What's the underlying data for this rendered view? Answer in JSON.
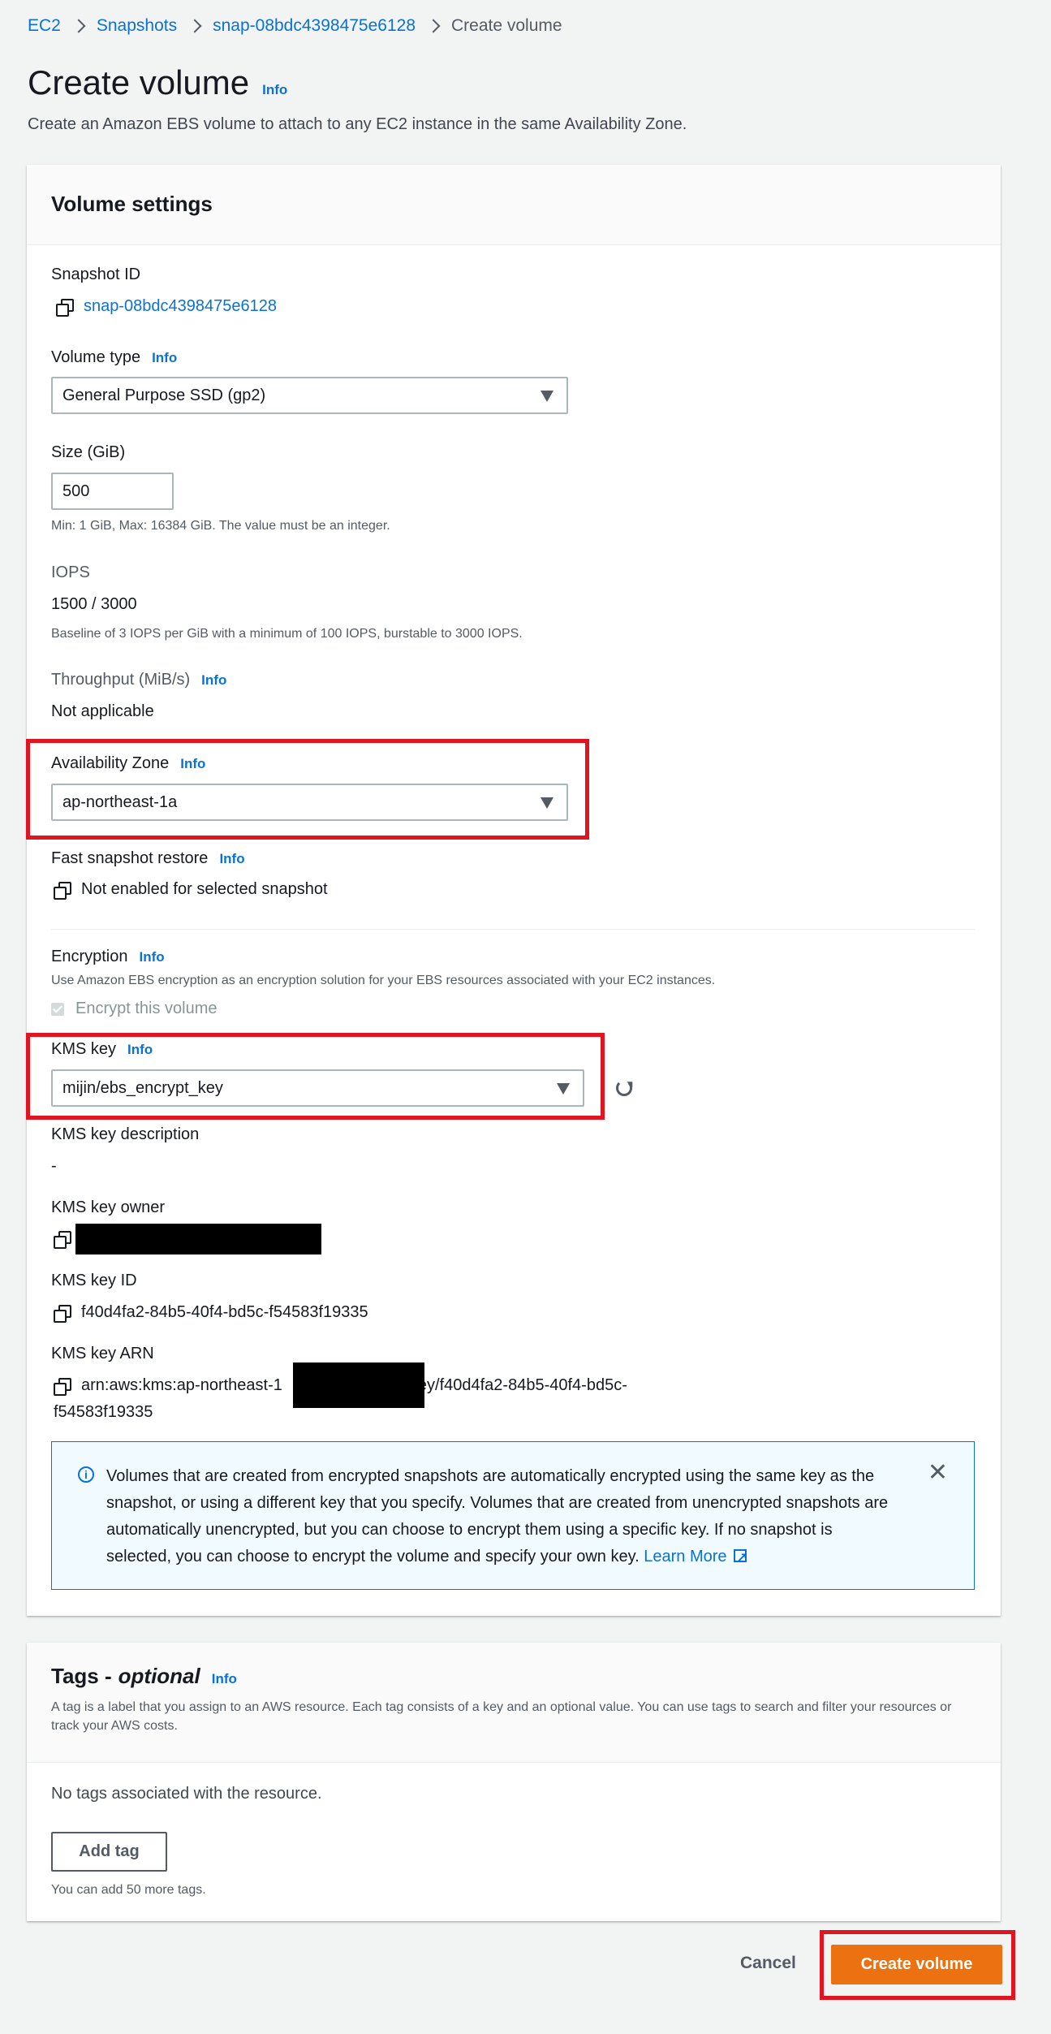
{
  "breadcrumb": {
    "items": [
      "EC2",
      "Snapshots",
      "snap-08bdc4398475e6128"
    ],
    "current": "Create volume"
  },
  "header": {
    "title": "Create volume",
    "info": "Info",
    "description": "Create an Amazon EBS volume to attach to any EC2 instance in the same Availability Zone."
  },
  "volume_settings": {
    "title": "Volume settings",
    "snapshot_id_label": "Snapshot ID",
    "snapshot_id": "snap-08bdc4398475e6128",
    "volume_type_label": "Volume type",
    "volume_type": "General Purpose SSD (gp2)",
    "size_label": "Size (GiB)",
    "size_value": "500",
    "size_hint": "Min: 1 GiB, Max: 16384 GiB. The value must be an integer.",
    "iops_label": "IOPS",
    "iops_value": "1500 / 3000",
    "iops_hint": "Baseline of 3 IOPS per GiB with a minimum of 100 IOPS, burstable to 3000 IOPS.",
    "throughput_label": "Throughput (MiB/s)",
    "throughput_value": "Not applicable",
    "az_label": "Availability Zone",
    "az_value": "ap-northeast-1a",
    "fsr_label": "Fast snapshot restore",
    "fsr_value": "Not enabled for selected snapshot",
    "encryption_label": "Encryption",
    "encryption_desc": "Use Amazon EBS encryption as an encryption solution for your EBS resources associated with your EC2 instances.",
    "encrypt_checkbox": "Encrypt this volume",
    "kms_key_label": "KMS key",
    "kms_key_value": "mijin/ebs_encrypt_key",
    "kms_desc_label": "KMS key description",
    "kms_desc_value": "-",
    "kms_owner_label": "KMS key owner",
    "kms_id_label": "KMS key ID",
    "kms_id_value": "f40d4fa2-84b5-40f4-bd5c-f54583f19335",
    "kms_arn_label": "KMS key ARN",
    "kms_arn_prefix": "arn:aws:kms:ap-northeast-1",
    "kms_arn_suffix": "key/f40d4fa2-84b5-40f4-bd5c-",
    "kms_arn_line2": "f54583f19335",
    "alert_text": "Volumes that are created from encrypted snapshots are automatically encrypted using the same key as the snapshot, or using a different key that you specify. Volumes that are created from unencrypted snapshots are automatically unencrypted, but you can choose to encrypt them using a specific key. If no snapshot is selected, you can choose to encrypt the volume and specify your own key.",
    "alert_link": "Learn More"
  },
  "tags": {
    "title": "Tags -",
    "title_optional": "optional",
    "description": "A tag is a label that you assign to an AWS resource. Each tag consists of a key and an optional value. You can use tags to search and filter your resources or track your AWS costs.",
    "empty_text": "No tags associated with the resource.",
    "add_tag": "Add tag",
    "hint": "You can add 50 more tags."
  },
  "footer": {
    "cancel": "Cancel",
    "create": "Create volume"
  },
  "icons": {
    "copy": "copy-icon",
    "info_circle": "info-circle-icon",
    "close": "close-icon",
    "refresh": "refresh-icon",
    "external": "external-link-icon"
  },
  "colors": {
    "link": "#0972d3",
    "primary": "#ec7211",
    "highlight": "#e0151f"
  }
}
